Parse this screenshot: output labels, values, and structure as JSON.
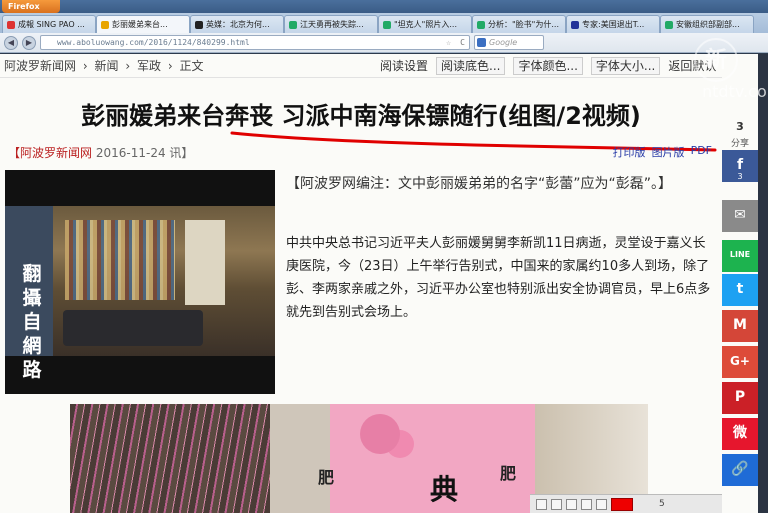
{
  "browser": {
    "menu_button": "Firefox",
    "tabs": [
      {
        "label": "成報 SING PAO ...",
        "color": "#d33"
      },
      {
        "label": "彭丽媛弟来台...",
        "color": "#e8a400"
      },
      {
        "label": "英媒：北京为何...",
        "color": "#222"
      },
      {
        "label": "江天勇再被失踪...",
        "color": "#2a6"
      },
      {
        "label": "\"坦克人\"照片入...",
        "color": "#2a6"
      },
      {
        "label": "分析：\"脸书\"为什...",
        "color": "#2a6"
      },
      {
        "label": "专家:美国退出T...",
        "color": "#239"
      },
      {
        "label": "安徽组织部副部...",
        "color": "#2a6"
      }
    ],
    "url": "www.aboluowang.com/2016/1124/840299.html",
    "search_placeholder": "Google",
    "back_icon": "◀",
    "forward_icon": "▶",
    "star_icon": "☆",
    "reload_icon": "C"
  },
  "page": {
    "breadcrumbs": [
      "阿波罗新闻网",
      "›",
      "新闻",
      "›",
      "军政",
      "›",
      "正文"
    ],
    "reading_settings": "阅读设置",
    "bg_select": "阅读底色...",
    "font_color_select": "字体颜色...",
    "font_size_select": "字体大小...",
    "return_default": "返回默认",
    "headline": "彭丽媛弟来台奔丧 习派中南海保镖随行(组图/2视频)",
    "source_site": "【阿波罗新闻网",
    "source_date": "2016-11-24 讯】",
    "print_version": "打印版",
    "image_version": "图片版",
    "pdf": "PDF",
    "photo_caption_vertical": "翻攝自網路",
    "editor_note": "【阿波罗网编注：文中彭丽媛弟弟的名字“彭蕾”应为“彭磊”。】",
    "body": "中共中央总书记习近平夫人彭丽媛舅舅李新凯11日病逝，灵堂设于嘉义长庚医院，今（23日）上午举行告别式，中国来的家属约10多人到场，除了彭、李两家亲戚之外，习近平办公室也特别派出安全协调官员，早上6点多就先到告别式会场上。",
    "photo2_chars": [
      "肥",
      "典",
      "肥"
    ],
    "status_zoom": "5"
  },
  "share": {
    "count": "3",
    "label": "分享",
    "buttons": [
      {
        "name": "facebook",
        "glyph": "f",
        "color": "#3b5998",
        "count": "3"
      },
      {
        "name": "email",
        "glyph": "✉",
        "color": "#8a8a8a",
        "count": ""
      },
      {
        "name": "line",
        "glyph": "LINE",
        "color": "#1db34f",
        "count": ""
      },
      {
        "name": "twitter",
        "glyph": "t",
        "color": "#1da1f2",
        "count": ""
      },
      {
        "name": "gmail",
        "glyph": "M",
        "color": "#d44638",
        "count": ""
      },
      {
        "name": "google-plus",
        "glyph": "G+",
        "color": "#dd4b39",
        "count": ""
      },
      {
        "name": "pinterest",
        "glyph": "P",
        "color": "#cb2027",
        "count": ""
      },
      {
        "name": "weibo",
        "glyph": "微",
        "color": "#e6162d",
        "count": ""
      },
      {
        "name": "link",
        "glyph": "🔗",
        "color": "#1f6bd6",
        "count": ""
      }
    ]
  },
  "overlay": {
    "logo": "新",
    "watermark": "ntdtv.com"
  },
  "colors": {
    "headline_underline": "#e00000",
    "link_blue": "#2a3da8"
  }
}
